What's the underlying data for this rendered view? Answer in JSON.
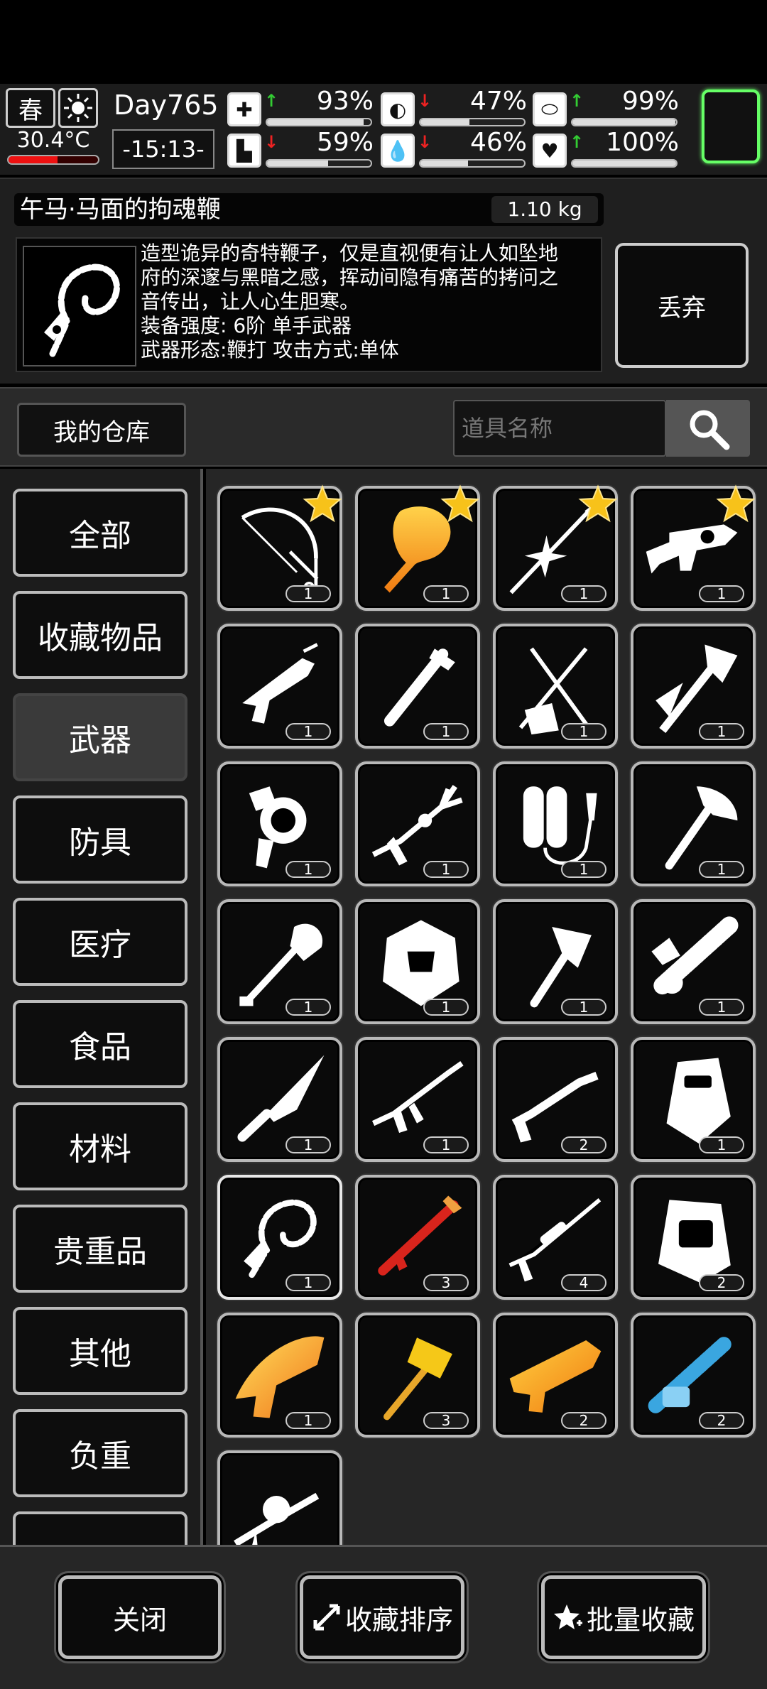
{
  "status": {
    "season": "春",
    "temperature": "30.4°C",
    "temperature_level": 0.55,
    "day": "Day765",
    "clock": "-15:13-",
    "stats": [
      {
        "icon": "medkit-icon",
        "trend": "up",
        "value": "93%",
        "level": 0.93
      },
      {
        "icon": "stomach-icon",
        "trend": "down",
        "value": "47%",
        "level": 0.47
      },
      {
        "icon": "helmet-icon",
        "trend": "up",
        "value": "99%",
        "level": 0.99
      },
      {
        "icon": "boot-icon",
        "trend": "down",
        "value": "59%",
        "level": 0.59
      },
      {
        "icon": "water-drop-icon",
        "trend": "down",
        "value": "46%",
        "level": 0.46
      },
      {
        "icon": "heart-icon",
        "trend": "up",
        "value": "100%",
        "level": 1.0
      }
    ],
    "colors": {
      "up": "#33cc33",
      "down": "#ee2222",
      "active_slot": "#66ff66"
    }
  },
  "detail": {
    "name": "午马·马面的拘魂鞭",
    "weight": "1.10 kg",
    "description": [
      "造型诡异的奇特鞭子，仅是直视便有让人如坠地",
      "府的深邃与黑暗之感，挥动间隐有痛苦的拷问之",
      "音传出，让人心生胆寒。",
      "装备强度: 6阶 单手武器",
      "武器形态:鞭打 攻击方式:单体"
    ],
    "discard_label": "丢弃"
  },
  "warehouse": {
    "label": "我的仓库",
    "search_placeholder": "道具名称"
  },
  "categories": [
    "全部",
    "收藏物品",
    "武器",
    "防具",
    "医疗",
    "食品",
    "材料",
    "贵重品",
    "其他",
    "负重"
  ],
  "active_category": "武器",
  "items": [
    {
      "name": "bow-icon",
      "count": "1",
      "fav": true
    },
    {
      "name": "golden-beast-club-icon",
      "count": "1",
      "fav": true
    },
    {
      "name": "ornate-spear-icon",
      "count": "1",
      "fav": true
    },
    {
      "name": "grenade-launcher-icon",
      "count": "1",
      "fav": true
    },
    {
      "name": "nail-gun-icon",
      "count": "1",
      "fav": false
    },
    {
      "name": "pipe-icon",
      "count": "1",
      "fav": false
    },
    {
      "name": "crossed-guitar-icon",
      "count": "1",
      "fav": false
    },
    {
      "name": "tomahawk-icon",
      "count": "1",
      "fav": false
    },
    {
      "name": "tesla-gun-icon",
      "count": "1",
      "fav": false
    },
    {
      "name": "trident-rifle-icon",
      "count": "1",
      "fav": false
    },
    {
      "name": "flamethrower-tank-icon",
      "count": "1",
      "fav": false
    },
    {
      "name": "axe-icon",
      "count": "1",
      "fav": false
    },
    {
      "name": "shovel-icon",
      "count": "1",
      "fav": false
    },
    {
      "name": "scale-shield-icon",
      "count": "1",
      "fav": false
    },
    {
      "name": "hatchet-icon",
      "count": "1",
      "fav": false
    },
    {
      "name": "dragon-chainsaw-icon",
      "count": "1",
      "fav": false
    },
    {
      "name": "combat-knife-icon",
      "count": "1",
      "fav": false
    },
    {
      "name": "assault-rifle-icon",
      "count": "1",
      "fav": false
    },
    {
      "name": "shotgun-icon",
      "count": "2",
      "fav": false
    },
    {
      "name": "riot-shield-icon",
      "count": "1",
      "fav": false
    },
    {
      "name": "soul-whip-icon",
      "count": "1",
      "fav": false,
      "selected": true
    },
    {
      "name": "rpg-launcher-icon",
      "count": "3",
      "fav": false
    },
    {
      "name": "sniper-rifle-icon",
      "count": "4",
      "fav": false
    },
    {
      "name": "tower-shield-icon",
      "count": "2",
      "fav": false
    },
    {
      "name": "golden-blade-gun-icon",
      "count": "1",
      "fav": false
    },
    {
      "name": "golden-hammer-icon",
      "count": "3",
      "fav": false
    },
    {
      "name": "golden-blaster-icon",
      "count": "2",
      "fav": false
    },
    {
      "name": "blue-minigun-icon",
      "count": "2",
      "fav": false
    },
    {
      "name": "heavy-machine-gun-icon",
      "count": "",
      "fav": false
    }
  ],
  "bottom": {
    "close_label": "关闭",
    "sort_label": "收藏排序",
    "batch_label": "批量收藏"
  }
}
